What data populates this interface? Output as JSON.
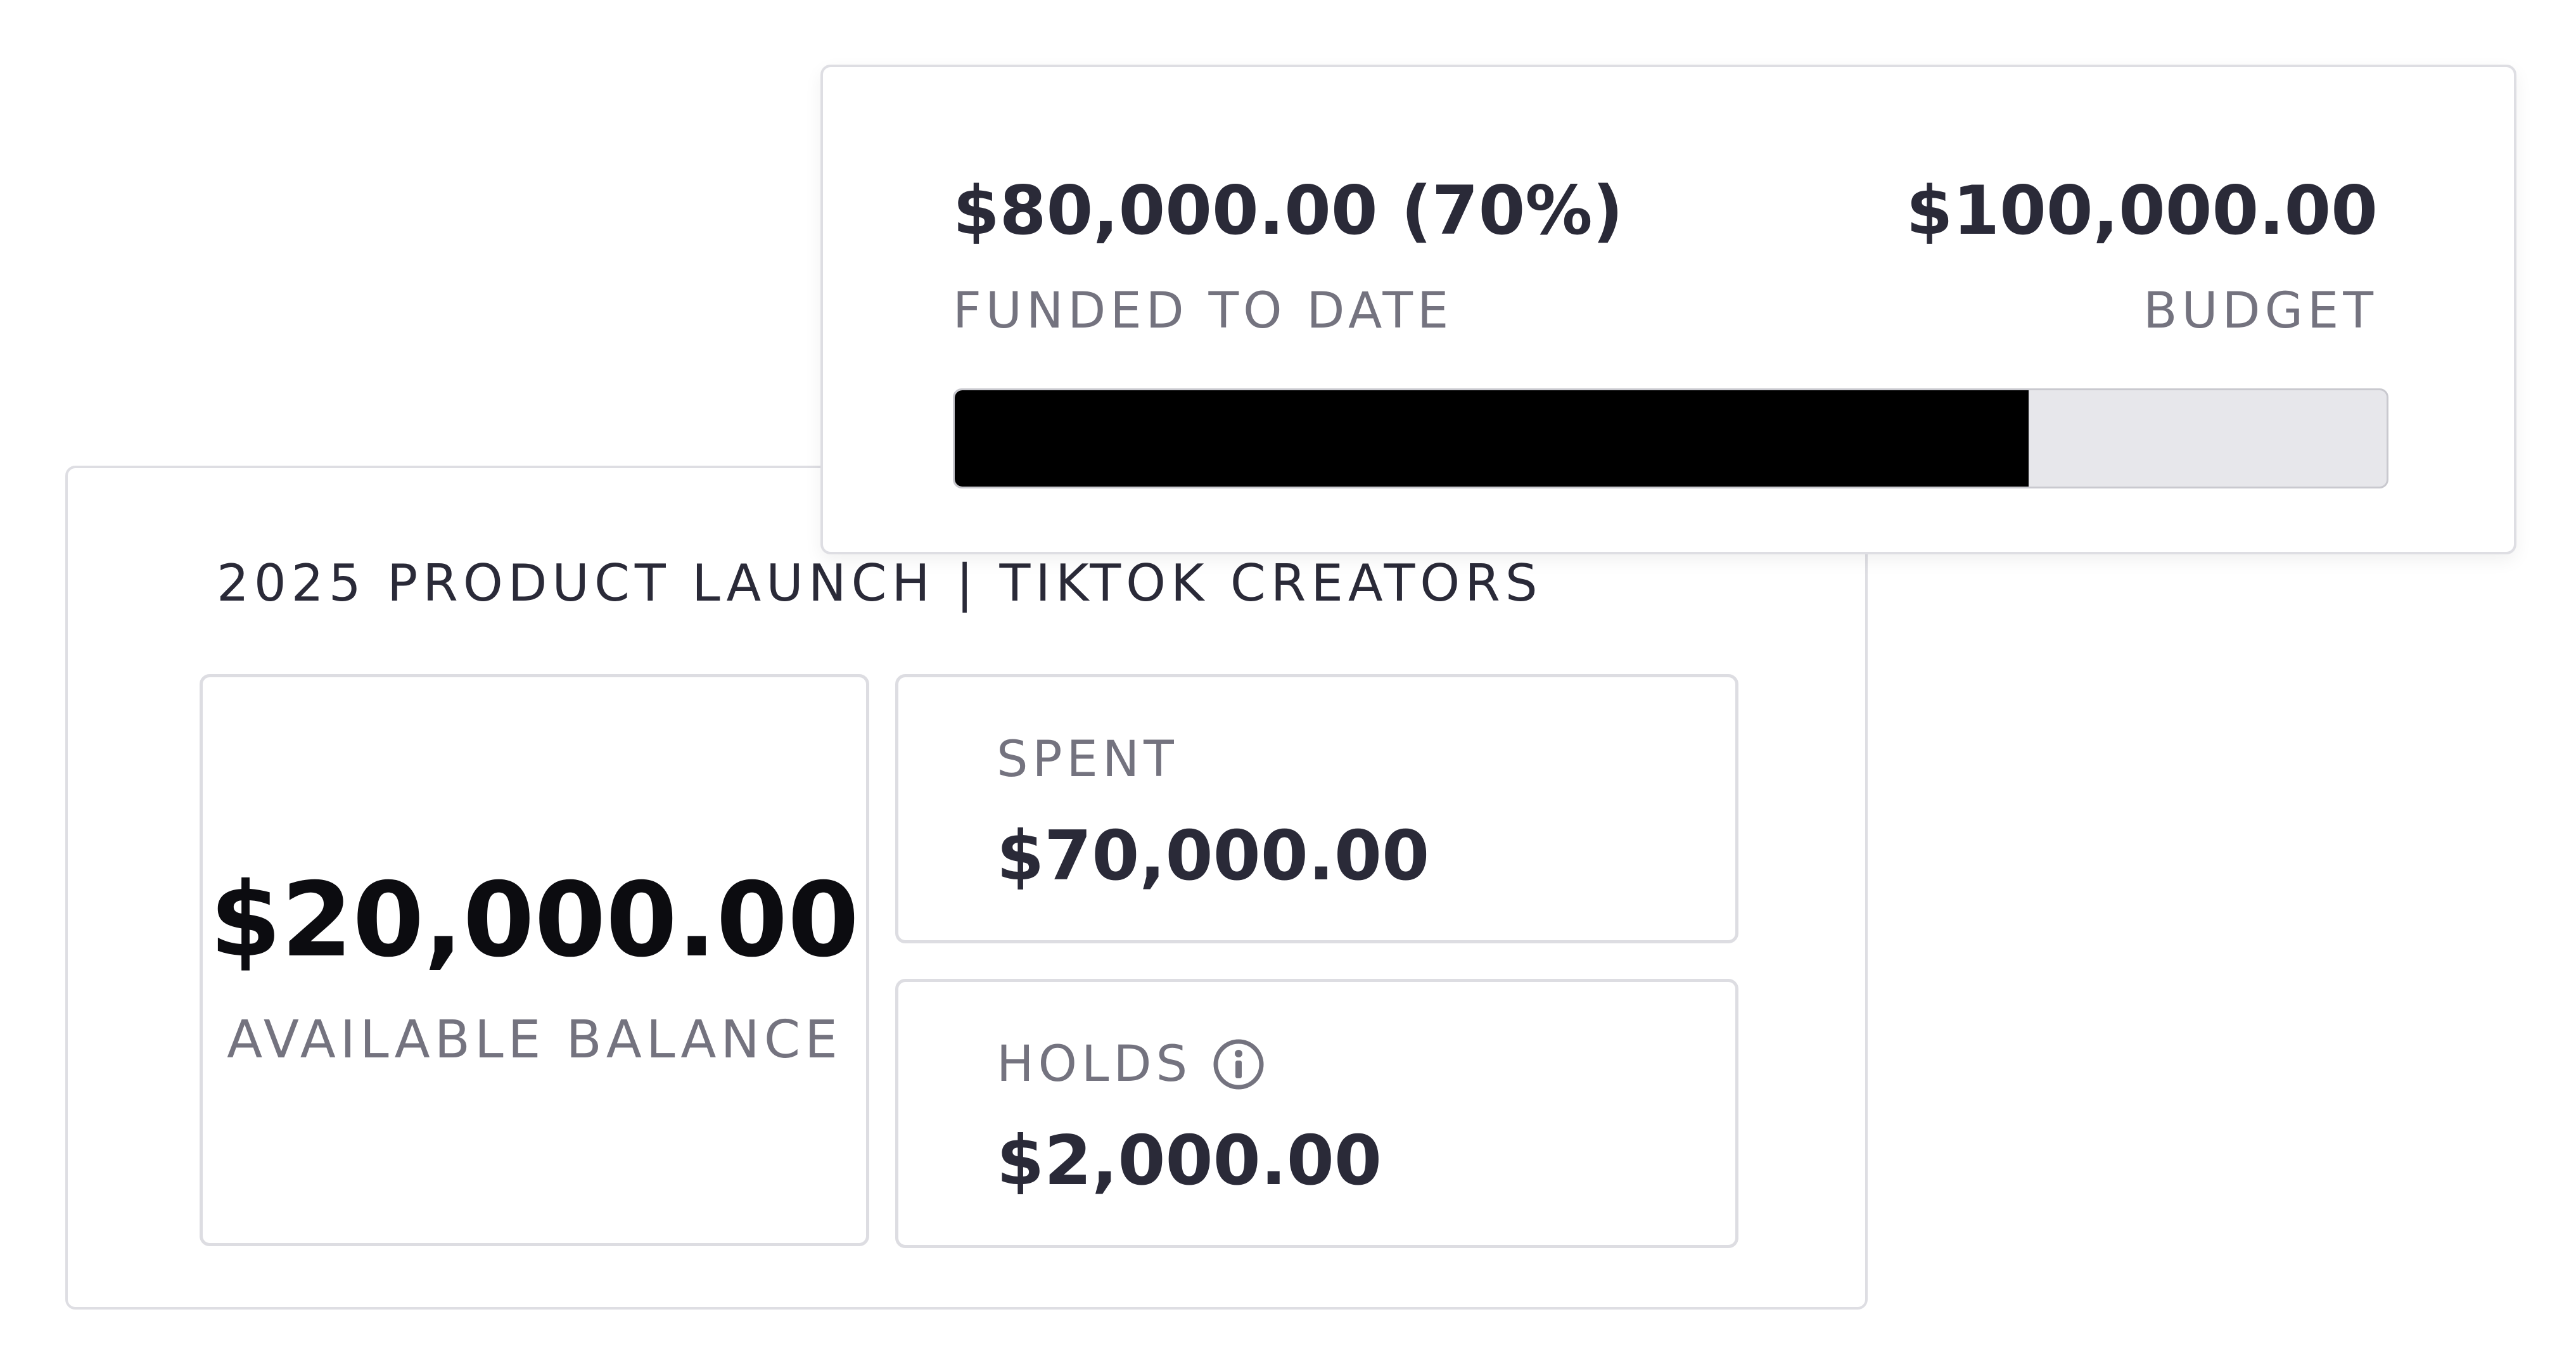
{
  "funding": {
    "funded_amount": "$80,000.00 (70%)",
    "funded_label": "FUNDED TO DATE",
    "budget_amount": "$100,000.00",
    "budget_label": "BUDGET",
    "progress_fraction": 0.75,
    "progress_fill_color": "#000000",
    "progress_track_color": "#e7e7eb"
  },
  "campaign": {
    "title": "2025 PRODUCT LAUNCH | TIKTOK CREATORS",
    "available_balance": {
      "amount": "$20,000.00",
      "label": "AVAILABLE BALANCE"
    },
    "spent": {
      "label": "SPENT",
      "amount": "$70,000.00"
    },
    "holds": {
      "label": "HOLDS",
      "amount": "$2,000.00",
      "icon": "info-icon"
    }
  }
}
